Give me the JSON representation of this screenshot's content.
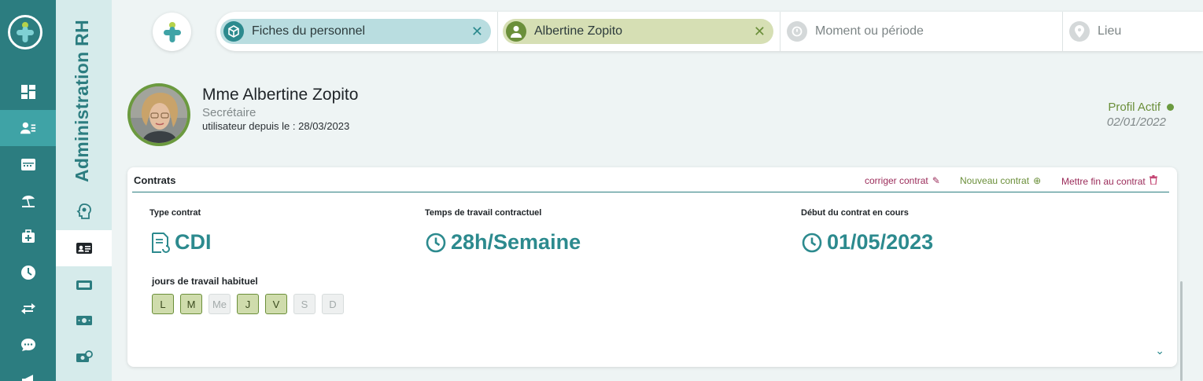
{
  "sidebar": {
    "items": [
      {
        "name": "dashboard-icon",
        "active": false
      },
      {
        "name": "users-list-icon",
        "active": true
      },
      {
        "name": "calendar-card-icon",
        "active": false
      },
      {
        "name": "beach-umbrella-icon",
        "active": false
      },
      {
        "name": "medical-kit-icon",
        "active": false
      },
      {
        "name": "clock-icon",
        "active": false
      },
      {
        "name": "transfer-arrows-icon",
        "active": false
      },
      {
        "name": "chat-icon",
        "active": false
      },
      {
        "name": "megaphone-icon",
        "active": false
      }
    ]
  },
  "subnav": {
    "title": "Administration RH",
    "items": [
      {
        "name": "head-gear-icon",
        "active": false
      },
      {
        "name": "id-card-icon",
        "active": true
      },
      {
        "name": "ticket-icon",
        "active": false
      },
      {
        "name": "banknote-icon",
        "active": false
      },
      {
        "name": "money-settings-icon",
        "active": false
      }
    ]
  },
  "filters": {
    "chip1": {
      "label": "Fiches du personnel",
      "icon": "cube-icon",
      "color": "#b9dde0"
    },
    "chip2": {
      "label": "Albertine Zopito",
      "icon": "person-icon",
      "color": "#d6dfb4"
    },
    "period_placeholder": "Moment ou période",
    "place_placeholder": "Lieu"
  },
  "profile": {
    "name": "Mme Albertine Zopito",
    "role": "Secrétaire",
    "since": "utilisateur depuis le : 28/03/2023",
    "status": "Profil Actif",
    "status_date": "02/01/2022"
  },
  "contracts": {
    "title": "Contrats",
    "actions": {
      "fix": "corriger contrat",
      "new": "Nouveau contrat",
      "end": "Mettre fin au contrat"
    },
    "type_label": "Type contrat",
    "type_value": "CDI",
    "hours_label": "Temps de travail contractuel",
    "hours_value": "28h/Semaine",
    "start_label": "Début du contrat en cours",
    "start_value": "01/05/2023",
    "days_label": "jours de travail habituel",
    "days": [
      {
        "label": "L",
        "on": true
      },
      {
        "label": "M",
        "on": true
      },
      {
        "label": "Me",
        "on": false
      },
      {
        "label": "J",
        "on": true
      },
      {
        "label": "V",
        "on": true
      },
      {
        "label": "S",
        "on": false
      },
      {
        "label": "D",
        "on": false
      }
    ]
  },
  "colors": {
    "primary": "#2c7d80",
    "accent": "#3fa3a6",
    "active_green": "#6b9a3f",
    "danger": "#9b2c5a"
  }
}
